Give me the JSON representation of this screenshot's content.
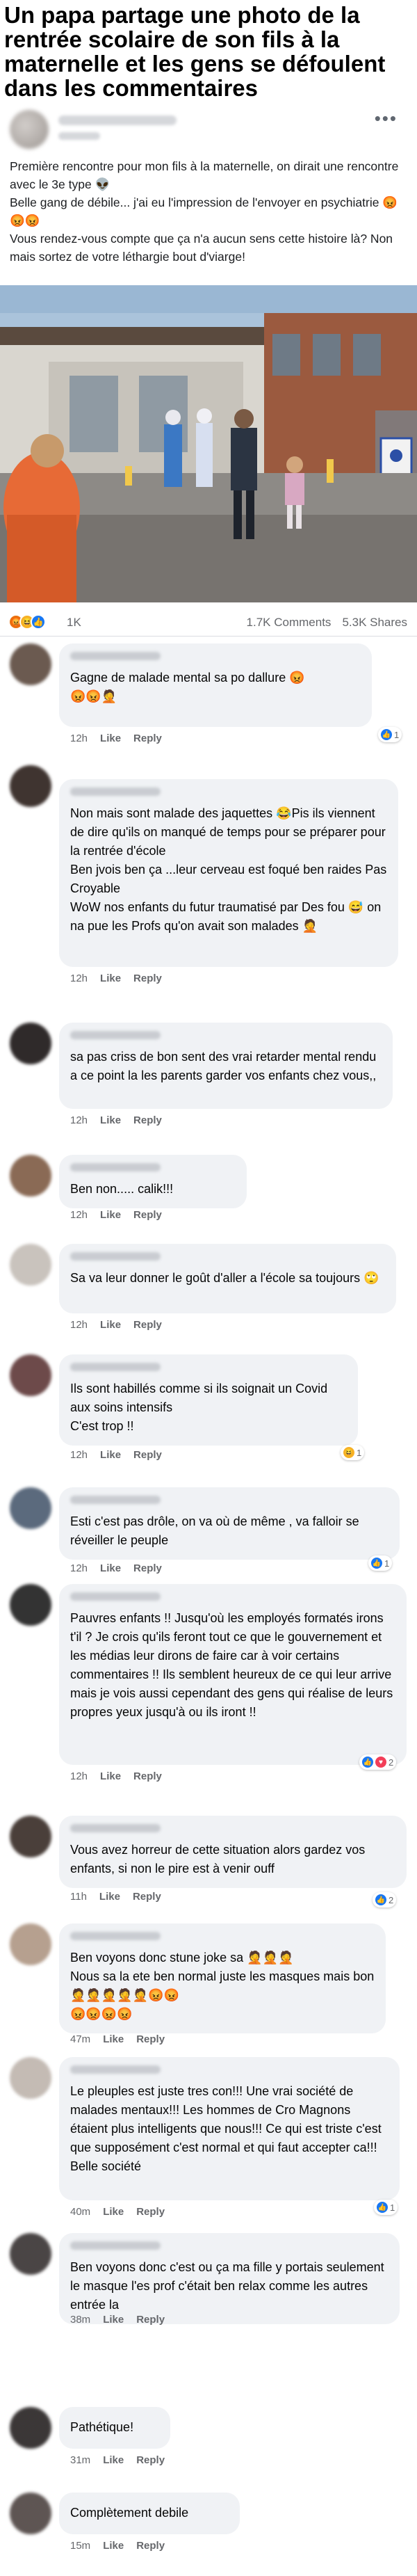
{
  "headline": "Un papa partage une photo de la rentrée scolaire de son fils à la maternelle et les gens se défoulent dans les commentaires",
  "post": {
    "menu": "•••",
    "text_lines": [
      "Première rencontre pour mon fils à la maternelle, on dirait une rencontre avec le 3e type 👽",
      "Belle gang de débile... j'ai eu l'impression de l'envoyer en psychiatrie 😡😡😡",
      "Vous rendez-vous compte que ça n'a aucun sens cette histoire là? Non mais sortez de votre léthargie bout d'viarge!"
    ],
    "reaction_count": "1K",
    "comments_count": "1.7K Comments",
    "shares_count": "5.3K Shares"
  },
  "actions": {
    "like": "Like",
    "reply": "Reply"
  },
  "comments": [
    {
      "text": "Gagne de malade mental sa po dallure 😡\n😡😡🤦",
      "time": "12h",
      "reactions": "1"
    },
    {
      "text": "Non mais sont malade des jaquettes 😂Pis ils viennent de dire qu'ils on manqué de temps pour se préparer pour la rentrée d'école\nBen jvois ben ça ...leur cerveau est foqué ben raides Pas Croyable\nWoW nos enfants du futur traumatisé par Des fou 😅 on na pue les Profs qu'on avait son malades 🤦",
      "time": "12h",
      "reactions": ""
    },
    {
      "text": "sa pas  criss  de bon  sent    des vrai retarder mental   rendu a  ce point la    les parents  garder vos  enfants   chez vous,,",
      "time": "12h",
      "reactions": ""
    },
    {
      "text": "Ben non..... calik!!!",
      "time": "12h",
      "reactions": ""
    },
    {
      "text": "Sa va leur donner le goût d'aller a l'école sa toujours 🙄",
      "time": "12h",
      "reactions": ""
    },
    {
      "text": "Ils sont habillés comme si ils soignait un Covid  aux soins intensifs\nC'est trop !!",
      "time": "12h",
      "reactions": "1"
    },
    {
      "text": "Esti c'est pas drôle,  on va où de même , va falloir se réveiller  le peuple",
      "time": "12h",
      "reactions": "1"
    },
    {
      "text": "Pauvres enfants !! Jusqu'où les employés formatés irons t'il ? Je crois qu'ils feront tout ce que le gouvernement et les médias leur dirons de faire car à voir certains commentaires !! Ils semblent heureux de ce qui leur arrive mais je vois aussi cependant des gens qui réalise de leurs propres yeux jusqu'à ou ils iront !!",
      "time": "12h",
      "reactions": "2"
    },
    {
      "text": "Vous avez horreur de cette situation alors gardez vos enfants, si non le pire est à venir ouff",
      "time": "11h",
      "reactions": "2"
    },
    {
      "text": "Ben voyons donc stune joke sa 🤦🤦🤦\nNous sa la ete ben normal juste les masques mais bon 🤦🤦🤦🤦🤦😡😡\n😡😡😡😡",
      "time": "47m",
      "reactions": ""
    },
    {
      "text": "Le pleuples est juste tres con!!! Une vrai société de malades mentaux!!! Les hommes de Cro Magnons étaient plus intelligents que nous!!! Ce qui est triste c'est que supposément c'est normal et qui faut accepter ca!!! Belle société",
      "time": "40m",
      "reactions": "1"
    },
    {
      "text": "Ben voyons donc c'est ou ça ma fille y portais seulement le masque l'es prof c'était ben relax comme les autres entrée la",
      "time": "38m",
      "reactions": ""
    },
    {
      "text": "Pathétique!",
      "time": "31m",
      "reactions": ""
    },
    {
      "text": "Complètement debile",
      "time": "15m",
      "reactions": ""
    }
  ],
  "colors": {
    "link": "#1877f2",
    "meta": "#65676b",
    "bubble": "#f0f2f5"
  }
}
